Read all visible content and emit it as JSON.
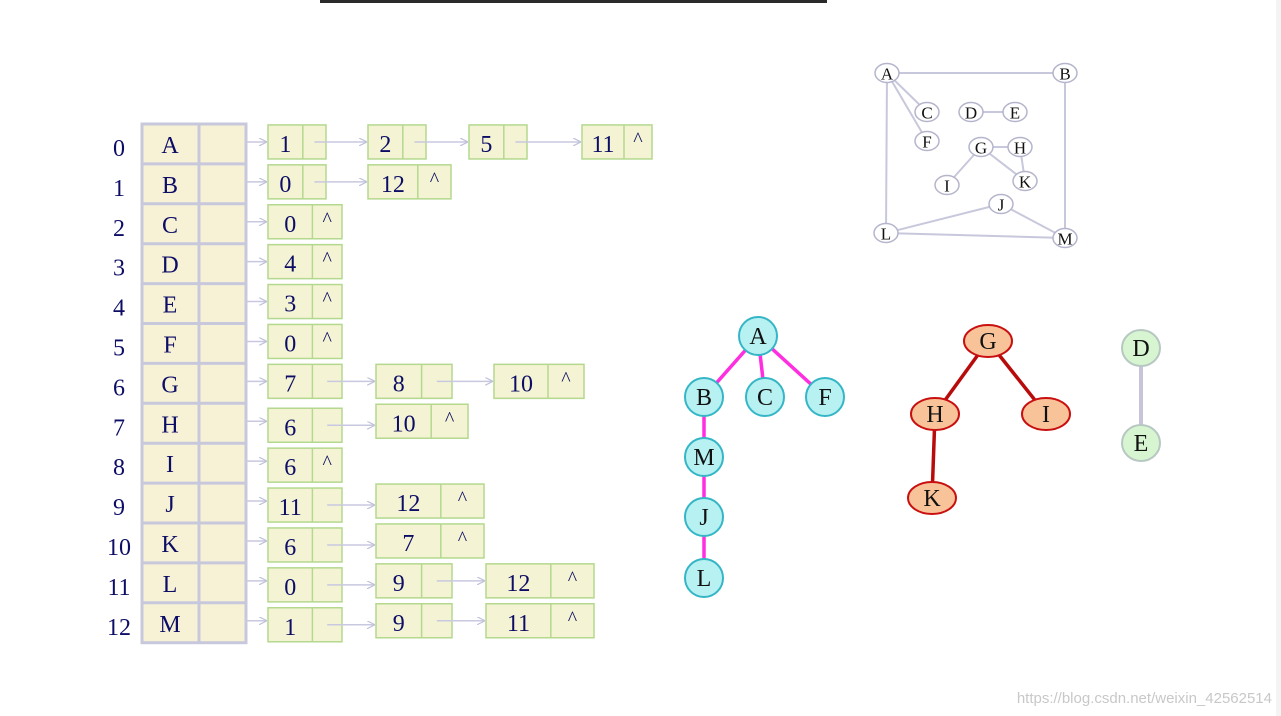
{
  "adjacency": {
    "rows": [
      {
        "index": "0",
        "vertex": "A",
        "edges": [
          {
            "v": "1",
            "end": ""
          },
          {
            "v": "2",
            "end": ""
          },
          {
            "v": "5",
            "end": ""
          },
          {
            "v": "11",
            "end": "^"
          }
        ]
      },
      {
        "index": "1",
        "vertex": "B",
        "edges": [
          {
            "v": "0",
            "end": ""
          },
          {
            "v": "12",
            "end": "^"
          }
        ]
      },
      {
        "index": "2",
        "vertex": "C",
        "edges": [
          {
            "v": "0",
            "end": "^"
          }
        ]
      },
      {
        "index": "3",
        "vertex": "D",
        "edges": [
          {
            "v": "4",
            "end": "^"
          }
        ]
      },
      {
        "index": "4",
        "vertex": "E",
        "edges": [
          {
            "v": "3",
            "end": "^"
          }
        ]
      },
      {
        "index": "5",
        "vertex": "F",
        "edges": [
          {
            "v": "0",
            "end": "^"
          }
        ]
      },
      {
        "index": "6",
        "vertex": "G",
        "edges": [
          {
            "v": "7",
            "end": ""
          },
          {
            "v": "8",
            "end": ""
          },
          {
            "v": "10",
            "end": "^"
          }
        ]
      },
      {
        "index": "7",
        "vertex": "H",
        "edges": [
          {
            "v": "6",
            "end": ""
          },
          {
            "v": "10",
            "end": "^"
          }
        ]
      },
      {
        "index": "8",
        "vertex": "I",
        "edges": [
          {
            "v": "6",
            "end": "^"
          }
        ]
      },
      {
        "index": "9",
        "vertex": "J",
        "edges": [
          {
            "v": "11",
            "end": ""
          },
          {
            "v": "12",
            "end": "^"
          }
        ]
      },
      {
        "index": "10",
        "vertex": "K",
        "edges": [
          {
            "v": "6",
            "end": ""
          },
          {
            "v": "7",
            "end": "^"
          }
        ]
      },
      {
        "index": "11",
        "vertex": "L",
        "edges": [
          {
            "v": "0",
            "end": ""
          },
          {
            "v": "9",
            "end": ""
          },
          {
            "v": "12",
            "end": "^"
          }
        ]
      },
      {
        "index": "12",
        "vertex": "M",
        "edges": [
          {
            "v": "1",
            "end": ""
          },
          {
            "v": "9",
            "end": ""
          },
          {
            "v": "11",
            "end": "^"
          }
        ]
      }
    ]
  },
  "graph": {
    "nodes": [
      "A",
      "B",
      "C",
      "D",
      "E",
      "F",
      "G",
      "H",
      "I",
      "J",
      "K",
      "L",
      "M"
    ],
    "edges": [
      [
        "A",
        "B"
      ],
      [
        "A",
        "C"
      ],
      [
        "A",
        "F"
      ],
      [
        "A",
        "L"
      ],
      [
        "B",
        "M"
      ],
      [
        "D",
        "E"
      ],
      [
        "G",
        "H"
      ],
      [
        "G",
        "I"
      ],
      [
        "G",
        "K"
      ],
      [
        "H",
        "K"
      ],
      [
        "J",
        "L"
      ],
      [
        "J",
        "M"
      ],
      [
        "L",
        "M"
      ]
    ]
  },
  "forest": {
    "trees": [
      {
        "nodes": [
          "A",
          "B",
          "C",
          "F",
          "M",
          "J",
          "L"
        ],
        "edges": [
          [
            "A",
            "B"
          ],
          [
            "A",
            "C"
          ],
          [
            "A",
            "F"
          ],
          [
            "B",
            "M"
          ],
          [
            "M",
            "J"
          ],
          [
            "J",
            "L"
          ]
        ],
        "fill": "#b8f1f1",
        "stroke": "#35b6c6",
        "edge_color": "#ff2ee0"
      },
      {
        "nodes": [
          "G",
          "H",
          "I",
          "K"
        ],
        "edges": [
          [
            "G",
            "H"
          ],
          [
            "G",
            "I"
          ],
          [
            "H",
            "K"
          ]
        ],
        "fill": "#f9c39a",
        "stroke": "#c91010",
        "edge_color": "#b80c0c"
      },
      {
        "nodes": [
          "D",
          "E"
        ],
        "edges": [
          [
            "D",
            "E"
          ]
        ],
        "fill": "#d6f5d0",
        "stroke": "#b7c8c2",
        "edge_color": "#c6c6d8"
      }
    ]
  },
  "watermark": "https://blog.csdn.net/weixin_42562514",
  "colors": {
    "index_text": "#0d0d66",
    "cell_fill": "#f7f2d6",
    "cell_border": "#c8c8dc",
    "node_box_fill": "#f4f4d4",
    "node_box_border": "#b4d88e",
    "arrow": "#c8c8e0",
    "graph_line": "#c8c8dc",
    "graph_node_stroke": "#b4b4cc"
  }
}
